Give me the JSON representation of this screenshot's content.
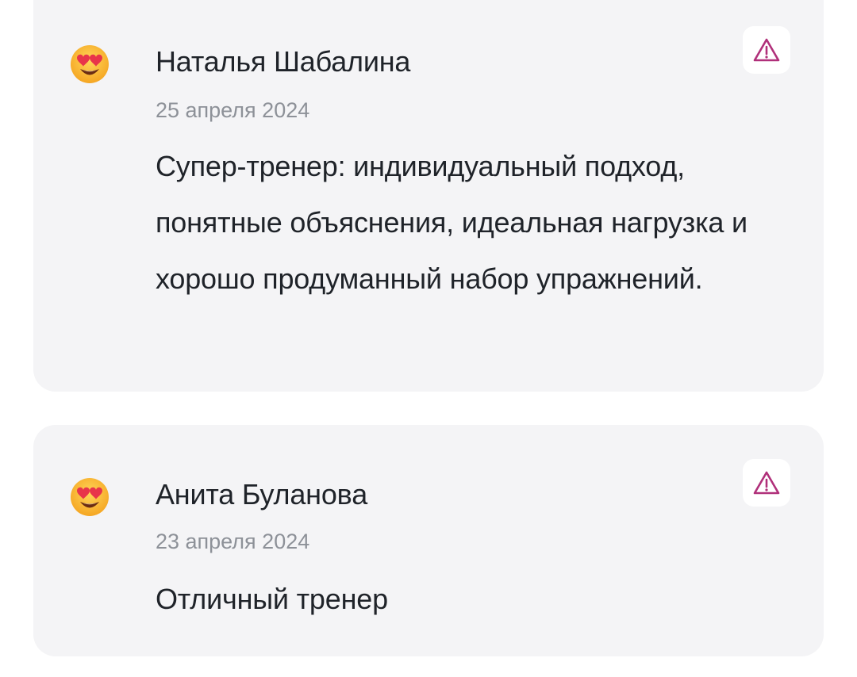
{
  "accent_color": "#b0307a",
  "reviews": [
    {
      "avatar_icon": "heart-eyes-emoji-icon",
      "author": "Наталья Шабалина",
      "date": "25 апреля 2024",
      "text": "Супер-тренер: индивидуальный подход, понятные объяснения, идеальная нагрузка и хорошо продуманный набор упражнений.",
      "report_icon": "warning-triangle-icon"
    },
    {
      "avatar_icon": "heart-eyes-emoji-icon",
      "author": "Анита Буланова",
      "date": "23 апреля 2024",
      "text": "Отличный тренер",
      "report_icon": "warning-triangle-icon"
    }
  ]
}
